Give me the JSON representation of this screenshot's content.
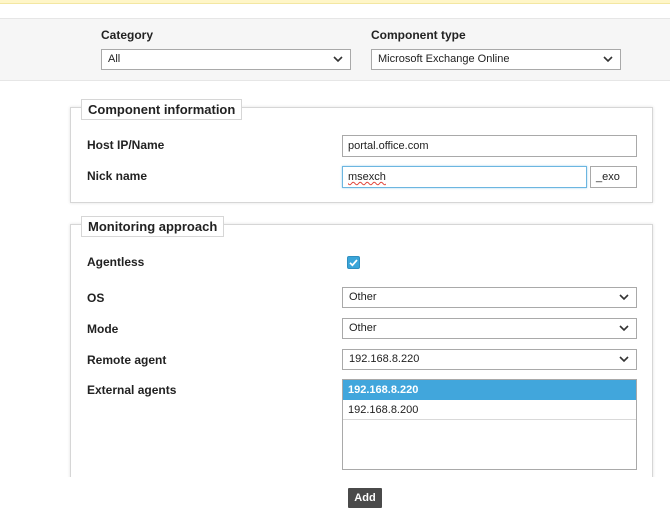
{
  "filters": {
    "category": {
      "label": "Category",
      "value": "All"
    },
    "component_type": {
      "label": "Component type",
      "value": "Microsoft Exchange Online"
    }
  },
  "component_info": {
    "title": "Component information",
    "host": {
      "label": "Host IP/Name",
      "value": "portal.office.com"
    },
    "nick": {
      "label": "Nick name",
      "value": "msexch",
      "suffix": "_exo"
    }
  },
  "monitoring": {
    "title": "Monitoring approach",
    "agentless": {
      "label": "Agentless",
      "checked": true
    },
    "os": {
      "label": "OS",
      "value": "Other"
    },
    "mode": {
      "label": "Mode",
      "value": "Other"
    },
    "remote_agent": {
      "label": "Remote agent",
      "value": "192.168.8.220"
    },
    "external_agents": {
      "label": "External agents",
      "options": [
        "192.168.8.220",
        "192.168.8.200"
      ],
      "selected_index": 0
    }
  },
  "actions": {
    "add_label": "Add"
  },
  "colors": {
    "accent": "#41a6dc",
    "button": "#4a4a4a",
    "top_banner": "#fff6c8"
  },
  "icons": {
    "dropdown": "chevron-down-icon",
    "check": "checkmark-icon"
  }
}
